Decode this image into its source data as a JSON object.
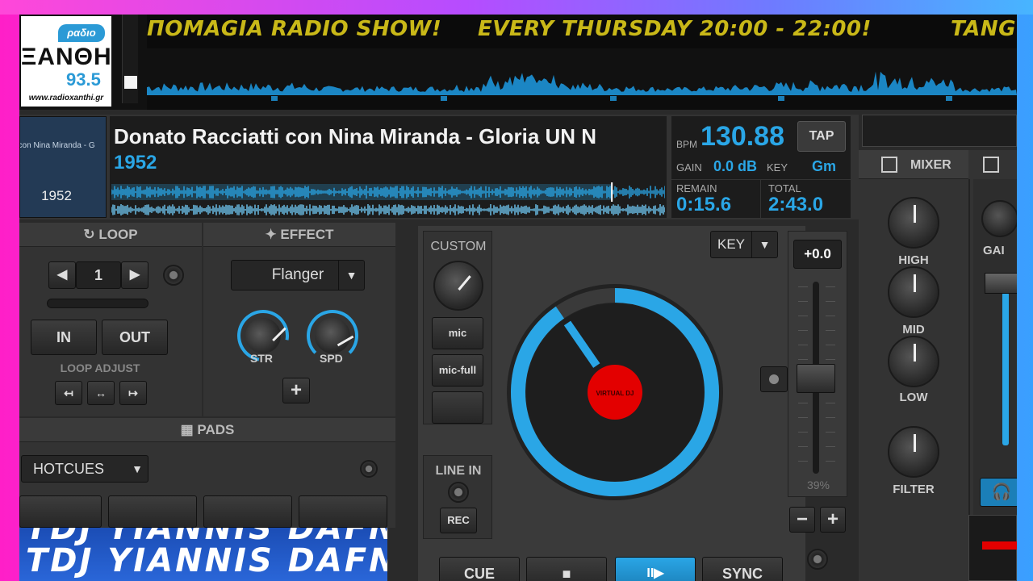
{
  "ticker": {
    "segments": [
      "ΠΟΜAGIA RADIO SHOW!",
      "EVERY THURSDAY 20:00 - 22:00!",
      "TANG"
    ]
  },
  "logo": {
    "radio": "ραδιο",
    "name": "ΞΑΝΘΗ",
    "freq": "93.5",
    "url": "www.radioxanthi.gr"
  },
  "deck": {
    "cover_title": "t con Nina Miranda - G",
    "cover_year": "1952",
    "title": "Donato Racciatti con Nina Miranda - Gloria UN N",
    "year": "1952",
    "bpm_label": "BPM",
    "bpm": "130.88",
    "tap": "TAP",
    "gain_label": "GAIN",
    "gain": "0.0 dB",
    "key_label": "KEY",
    "key": "Gm",
    "remain_label": "REMAIN",
    "remain": "0:15.6",
    "total_label": "TOTAL",
    "total": "2:43.0",
    "progress": 0.904
  },
  "loop": {
    "header": "LOOP",
    "value": "1",
    "in": "IN",
    "out": "OUT",
    "adjust": "LOOP ADJUST"
  },
  "effect": {
    "header": "EFFECT",
    "selected": "Flanger",
    "knob1": "STR",
    "knob2": "SPD",
    "add": "+"
  },
  "custom": {
    "header": "CUSTOM",
    "btn1": "mic",
    "btn2": "mic-full"
  },
  "linein": {
    "header": "LINE IN",
    "rec": "REC"
  },
  "pads": {
    "header": "PADS",
    "mode": "HOTCUES",
    "banner": "TDJ YIANNIS DAFNIS"
  },
  "transport": {
    "cue": "CUE",
    "stop": "■",
    "play": "II▶",
    "sync": "SYNC"
  },
  "pitch": {
    "value": "+0.0",
    "percent": "39%",
    "minus": "−",
    "plus": "+"
  },
  "key_control": {
    "label": "KEY"
  },
  "jog": {
    "label": "VIRTUAL DJ"
  },
  "mixer": {
    "header": "MIXER",
    "high": "HIGH",
    "mid": "MID",
    "low": "LOW",
    "filter": "FILTER",
    "gain": "GAI"
  },
  "colors": {
    "accent": "#2aa6e6",
    "ticker": "#c9b818",
    "jog_center": "#e30000"
  }
}
